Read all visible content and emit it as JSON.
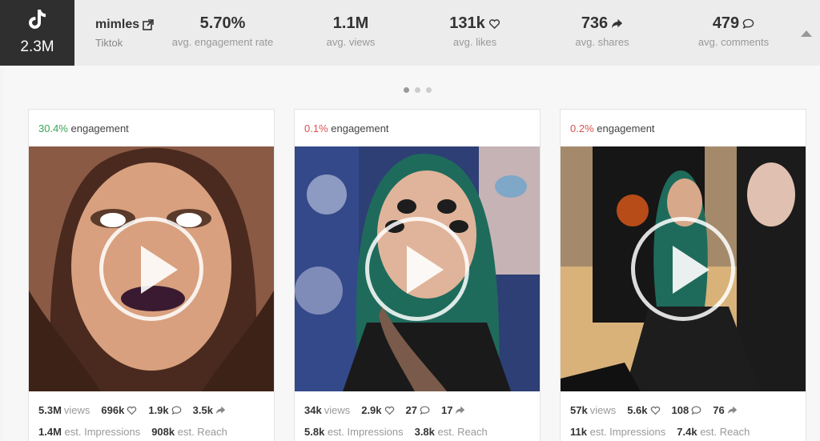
{
  "profile": {
    "followers": "2.3M",
    "name": "mimles",
    "platform": "Tiktok"
  },
  "stats": [
    {
      "value": "5.70%",
      "label": "avg. engagement rate",
      "icon": ""
    },
    {
      "value": "1.1M",
      "label": "avg. views",
      "icon": ""
    },
    {
      "value": "131k",
      "label": "avg. likes",
      "icon": "heart-icon"
    },
    {
      "value": "736",
      "label": "avg. shares",
      "icon": "share-icon"
    },
    {
      "value": "479",
      "label": "avg. comments",
      "icon": "comment-icon"
    }
  ],
  "pagination": {
    "pages": 3,
    "active": 1
  },
  "posts": [
    {
      "engagement_pct": "30.4%",
      "engagement_label": "engagement",
      "engagement_color": "#3aa655",
      "views": "5.3M",
      "views_label": "views",
      "likes": "696k",
      "comments": "1.9k",
      "shares": "3.5k",
      "impressions": "1.4M",
      "impressions_label": "est. Impressions",
      "reach": "908k",
      "reach_label": "est. Reach"
    },
    {
      "engagement_pct": "0.1%",
      "engagement_label": "engagement",
      "engagement_color": "#d9534f",
      "views": "34k",
      "views_label": "views",
      "likes": "2.9k",
      "comments": "27",
      "shares": "17",
      "impressions": "5.8k",
      "impressions_label": "est. Impressions",
      "reach": "3.8k",
      "reach_label": "est. Reach"
    },
    {
      "engagement_pct": "0.2%",
      "engagement_label": "engagement",
      "engagement_color": "#d9534f",
      "views": "57k",
      "views_label": "views",
      "likes": "5.6k",
      "comments": "108",
      "shares": "76",
      "impressions": "11k",
      "impressions_label": "est. Impressions",
      "reach": "7.4k",
      "reach_label": "est. Reach"
    }
  ]
}
